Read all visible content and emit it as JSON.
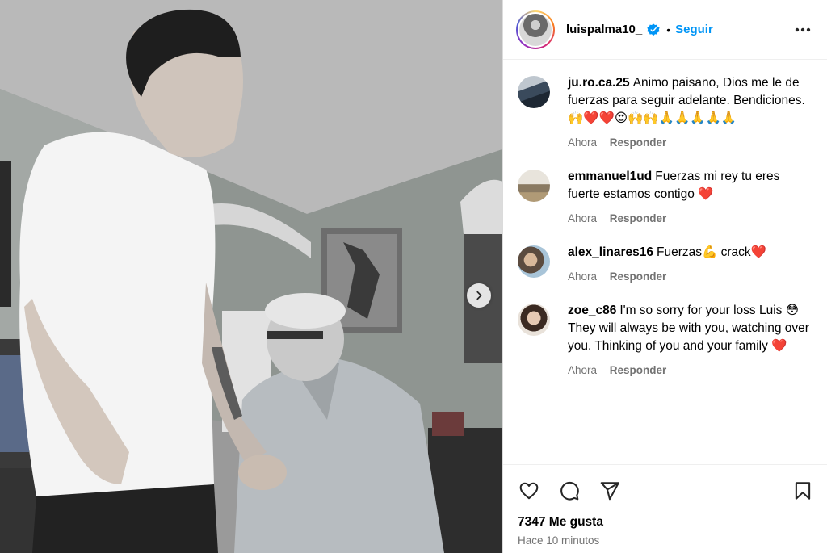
{
  "colors": {
    "accent": "#0095f6",
    "heart": "#ed4956",
    "muted": "#737373"
  },
  "post": {
    "header": {
      "username": "luispalma10_",
      "verified": true,
      "separator": "•",
      "follow_label": "Seguir",
      "more_icon": "more-horizontal-icon"
    },
    "media": {
      "next_icon": "chevron-right-icon",
      "description_visible": false
    },
    "comments": [
      {
        "user": "ju.ro.ca.25",
        "text": "Animo paisano, Dios me le de fuerzas para seguir adelante. Bendiciones.🙌❤️❤️😍🙌🙌🙏🙏🙏🙏🙏",
        "time": "Ahora",
        "reply_label": "Responder"
      },
      {
        "user": "emmanuel1ud",
        "text": "Fuerzas mi rey tu eres fuerte estamos contigo ❤️",
        "time": "Ahora",
        "reply_label": "Responder"
      },
      {
        "user": "alex_linares16",
        "text": "Fuerzas💪 crack❤️",
        "time": "Ahora",
        "reply_label": "Responder"
      },
      {
        "user": "zoe_c86",
        "text": "I'm so sorry for your loss Luis 😳 They will always be with you, watching over you. Thinking of you and your family ❤️",
        "time": "Ahora",
        "reply_label": "Responder"
      }
    ],
    "actions": {
      "like_icon": "heart-icon",
      "comment_icon": "comment-icon",
      "share_icon": "send-icon",
      "save_icon": "bookmark-icon"
    },
    "likes": "7347 Me gusta",
    "posted": "Hace 10 minutos"
  }
}
